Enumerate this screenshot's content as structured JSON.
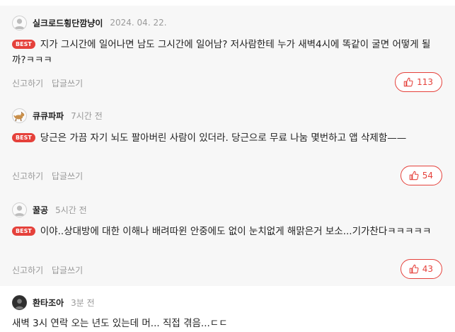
{
  "comments": [
    {
      "nickname": "실크로드횡단깜냥이",
      "time": "2024. 04. 22.",
      "best_label": "BEST",
      "text": "지가 그시간에 일어나면 남도 그시간에 일어남? 저사람한테 누가 새벽4시에 똑같이 굴면 어떻게 될까?ㅋㅋㅋ",
      "report_label": "신고하기",
      "reply_label": "답글쓰기",
      "likes": "113"
    },
    {
      "nickname": "큐큐파파",
      "time": "7시간 전",
      "best_label": "BEST",
      "text": "당근은 가끔 자기 뇌도 팔아버린 사람이 있더라. 당근으로 무료 나눔 몇번하고 앱 삭제함——",
      "report_label": "신고하기",
      "reply_label": "답글쓰기",
      "likes": "54"
    },
    {
      "nickname": "꿀공",
      "time": "5시간 전",
      "best_label": "BEST",
      "text": "이야..상대방에 대한 이해나 배려따윈 안중에도 없이 눈치없게 해맑은거 보소...기가찬다ㅋㅋㅋㅋㅋ",
      "report_label": "신고하기",
      "reply_label": "답글쓰기",
      "likes": "43"
    },
    {
      "nickname": "환타조아",
      "time": "3분 전",
      "text": "새벽 3시 연락 오는 년도 있는데 머... 직접 겪음...ㄷㄷ"
    }
  ],
  "colors": {
    "accent": "#e5413b",
    "best_background": "#f7f7f7",
    "meta_text": "#999999"
  },
  "icons": {
    "avatar_default": "person-silhouette-icon",
    "avatar_pet": "dog-icon",
    "avatar_photo": "portrait-icon",
    "like": "thumbs-up-icon"
  }
}
